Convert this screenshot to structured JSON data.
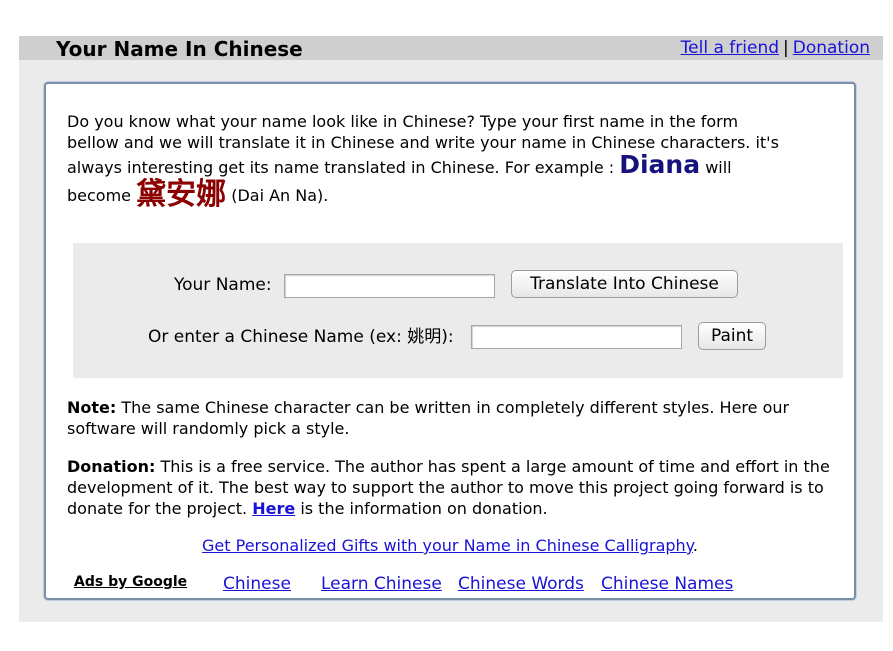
{
  "header": {
    "title": "Your Name In Chinese",
    "links": {
      "tell_friend": "Tell a friend",
      "separator": "|",
      "donation": "Donation"
    }
  },
  "intro": {
    "line1": "Do you know what your name look like in Chinese? Type your first name in the form",
    "line2": "bellow and we will translate it in Chinese and write your name in Chinese characters. it's",
    "line3_before": "always interesting get its name translated in Chinese. For example :",
    "example_name": "Diana",
    "line3_after": "will",
    "line4_before": "become",
    "example_chinese": "黛安娜",
    "example_pinyin": "(Dai An Na)."
  },
  "form": {
    "name_label": "Your Name:",
    "name_value": "",
    "translate_button": "Translate Into Chinese",
    "chinese_label": "Or enter a Chinese Name (ex: 姚明):",
    "chinese_value": "",
    "paint_button": "Paint"
  },
  "note": {
    "title": "Note:",
    "text": "The same Chinese character can be written in completely different styles. Here our software will randomly pick a style."
  },
  "donation": {
    "title": "Donation:",
    "text_before": "This is a free service. The author has spent a large amount of time and effort in the development of it. The best way to support the author to move this project going forward is to donate for the project.",
    "link": "Here",
    "text_after": "is the information on donation."
  },
  "gifts": {
    "link": "Get Personalized Gifts with your Name in Chinese Calligraphy",
    "period": "."
  },
  "ads": {
    "label": "Ads by Google",
    "links": [
      "Chinese",
      "Learn Chinese",
      "Chinese Words",
      "Chinese Names"
    ]
  }
}
